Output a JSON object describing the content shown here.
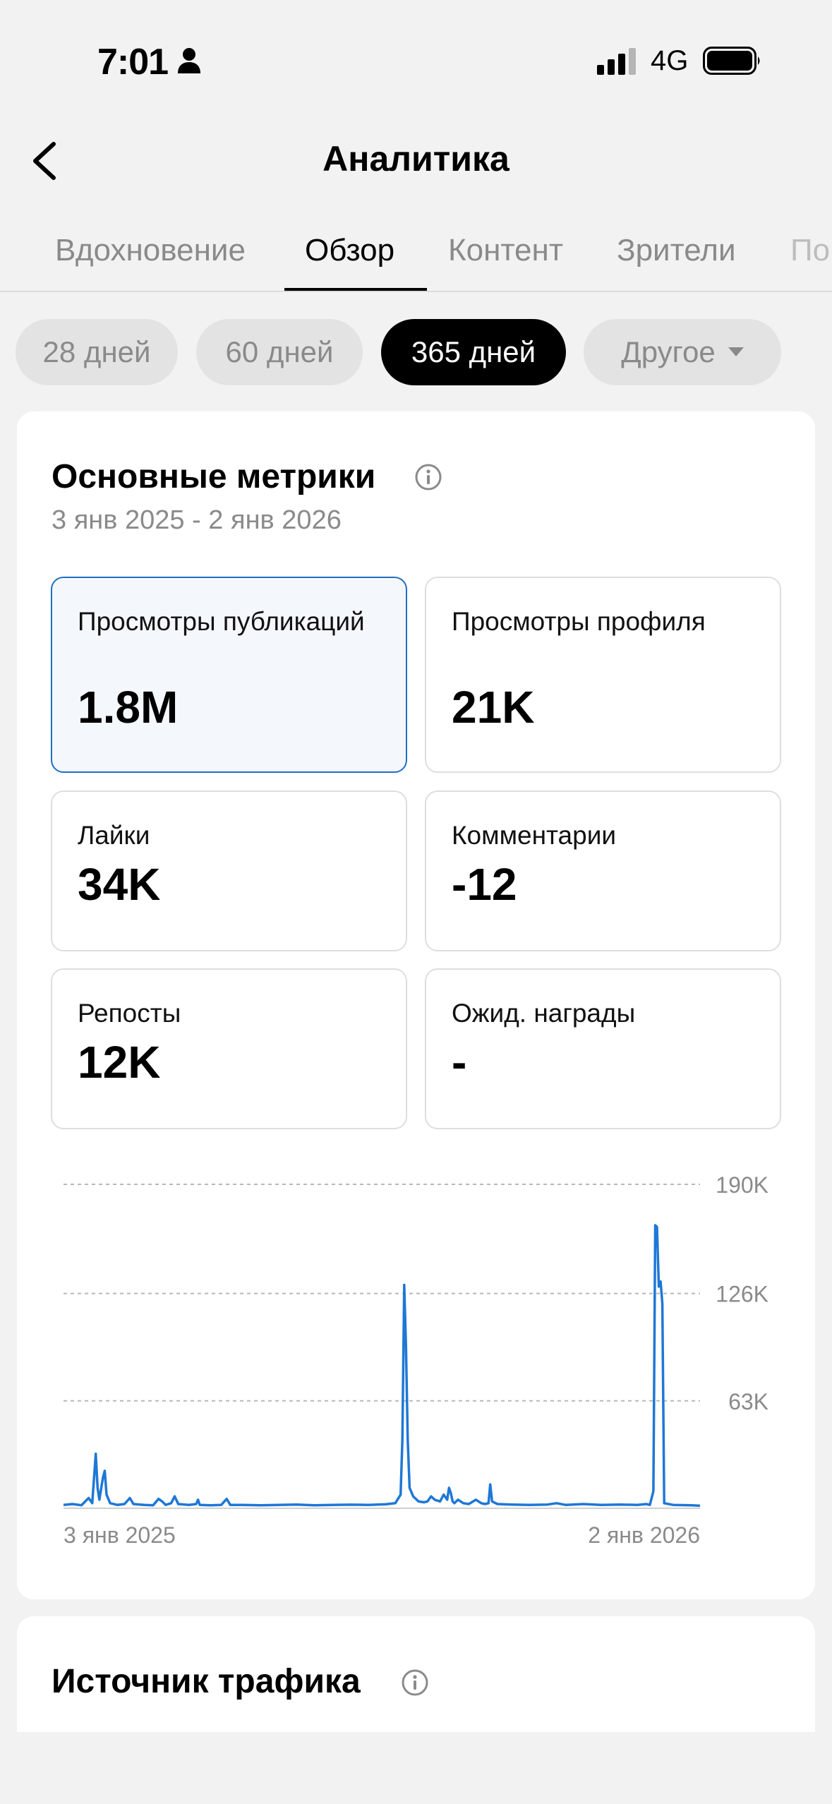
{
  "status_bar": {
    "time": "7:01",
    "network": "4G"
  },
  "header": {
    "title": "Аналитика"
  },
  "tabs": [
    {
      "label": "Вдохновение",
      "active": false
    },
    {
      "label": "Обзор",
      "active": true
    },
    {
      "label": "Контент",
      "active": false
    },
    {
      "label": "Зрители",
      "active": false
    },
    {
      "label": "По",
      "active": false
    }
  ],
  "periods": [
    {
      "label": "28 дней",
      "active": false
    },
    {
      "label": "60 дней",
      "active": false
    },
    {
      "label": "365 дней",
      "active": true
    },
    {
      "label": "Другое",
      "active": false
    }
  ],
  "metrics_section": {
    "title": "Основные метрики",
    "date_range": "3 янв 2025 - 2 янв 2026",
    "tiles": [
      {
        "label": "Просмотры публикаций",
        "value": "1.8M",
        "selected": true
      },
      {
        "label": "Просмотры профиля",
        "value": "21K",
        "selected": false
      },
      {
        "label": "Лайки",
        "value": "34K",
        "selected": false
      },
      {
        "label": "Комментарии",
        "value": "-12",
        "selected": false
      },
      {
        "label": "Репосты",
        "value": "12K",
        "selected": false
      },
      {
        "label": "Ожид. награды",
        "value": "-",
        "selected": false
      }
    ]
  },
  "chart_data": {
    "type": "line",
    "x_start_label": "3 янв 2025",
    "x_end_label": "2 янв 2026",
    "y_ticks": [
      "63K",
      "126K",
      "190K"
    ],
    "ylim": [
      0,
      190000
    ],
    "grid": true,
    "color": "#1f77d6",
    "series": [
      {
        "points": [
          [
            0,
            2000
          ],
          [
            5,
            2500
          ],
          [
            10,
            1800
          ],
          [
            14,
            6000
          ],
          [
            16,
            3000
          ],
          [
            18,
            32000
          ],
          [
            19,
            12000
          ],
          [
            20,
            5000
          ],
          [
            22,
            18000
          ],
          [
            23,
            22000
          ],
          [
            24,
            8000
          ],
          [
            26,
            3000
          ],
          [
            30,
            2000
          ],
          [
            34,
            2500
          ],
          [
            37,
            6000
          ],
          [
            39,
            2500
          ],
          [
            45,
            2000
          ],
          [
            50,
            1800
          ],
          [
            53,
            5500
          ],
          [
            55,
            4000
          ],
          [
            57,
            2000
          ],
          [
            60,
            3000
          ],
          [
            62,
            7000
          ],
          [
            64,
            2500
          ],
          [
            70,
            2000
          ],
          [
            74,
            2500
          ],
          [
            75,
            5000
          ],
          [
            76,
            2000
          ],
          [
            82,
            1800
          ],
          [
            88,
            2000
          ],
          [
            91,
            5500
          ],
          [
            93,
            2000
          ],
          [
            100,
            2000
          ],
          [
            110,
            1800
          ],
          [
            120,
            2000
          ],
          [
            130,
            2200
          ],
          [
            140,
            1800
          ],
          [
            150,
            2000
          ],
          [
            160,
            2100
          ],
          [
            170,
            2000
          ],
          [
            180,
            2400
          ],
          [
            185,
            3000
          ],
          [
            188,
            8000
          ],
          [
            189,
            40000
          ],
          [
            190,
            131000
          ],
          [
            191,
            95000
          ],
          [
            192,
            40000
          ],
          [
            193,
            12000
          ],
          [
            195,
            7000
          ],
          [
            198,
            4000
          ],
          [
            201,
            3500
          ],
          [
            203,
            4000
          ],
          [
            205,
            7000
          ],
          [
            207,
            5000
          ],
          [
            210,
            4000
          ],
          [
            212,
            8000
          ],
          [
            214,
            5000
          ],
          [
            215,
            12000
          ],
          [
            216,
            9000
          ],
          [
            217,
            4000
          ],
          [
            218,
            3000
          ],
          [
            220,
            5000
          ],
          [
            223,
            3000
          ],
          [
            226,
            2500
          ],
          [
            230,
            5000
          ],
          [
            233,
            3000
          ],
          [
            235,
            2500
          ],
          [
            237,
            3000
          ],
          [
            238,
            14000
          ],
          [
            239,
            4000
          ],
          [
            242,
            2500
          ],
          [
            250,
            2200
          ],
          [
            260,
            2000
          ],
          [
            270,
            2200
          ],
          [
            275,
            3000
          ],
          [
            280,
            2000
          ],
          [
            290,
            2500
          ],
          [
            300,
            2000
          ],
          [
            310,
            2200
          ],
          [
            320,
            2000
          ],
          [
            325,
            2500
          ],
          [
            327,
            2000
          ],
          [
            329,
            10000
          ],
          [
            330,
            166000
          ],
          [
            331,
            165000
          ],
          [
            332,
            130000
          ],
          [
            333,
            133000
          ],
          [
            334,
            120000
          ],
          [
            335,
            3000
          ],
          [
            340,
            2000
          ],
          [
            350,
            1800
          ],
          [
            355,
            1500
          ]
        ]
      }
    ]
  },
  "traffic_section": {
    "title": "Источник трафика"
  }
}
